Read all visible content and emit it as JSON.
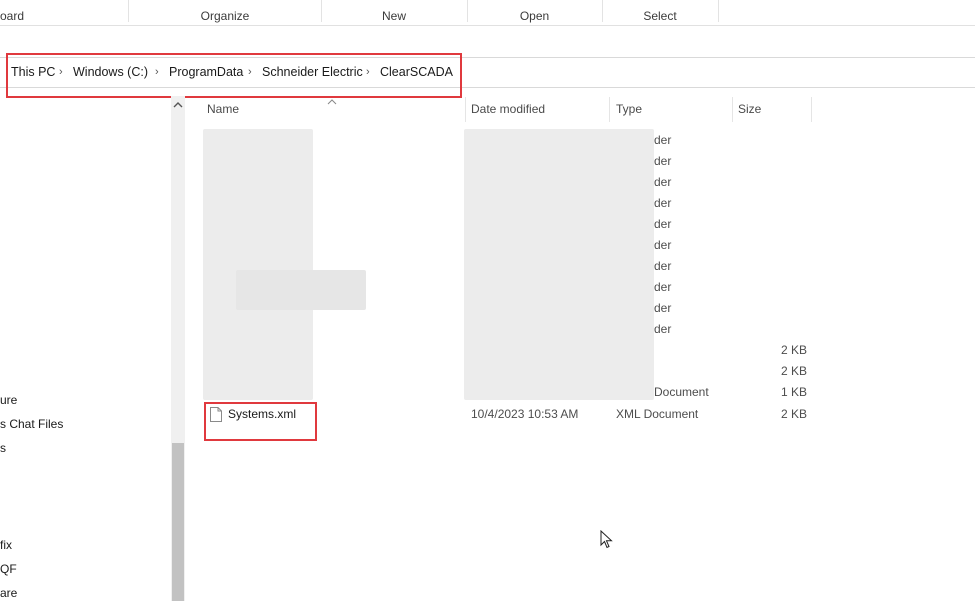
{
  "ribbon": {
    "groups": [
      "oard",
      "Organize",
      "New",
      "Open",
      "Select"
    ]
  },
  "breadcrumb": {
    "items": [
      "This PC",
      "Windows (C:)",
      "ProgramData",
      "Schneider Electric",
      "ClearSCADA"
    ],
    "separator": "›"
  },
  "nav": {
    "items": [
      "ure",
      "s Chat Files",
      "s",
      "fix",
      "QF",
      "are"
    ]
  },
  "columns": {
    "name": "Name",
    "date": "Date modified",
    "type": "Type",
    "size": "Size"
  },
  "partial_rows": [
    {
      "type": "der",
      "size": ""
    },
    {
      "type": "der",
      "size": ""
    },
    {
      "type": "der",
      "size": ""
    },
    {
      "type": "der",
      "size": ""
    },
    {
      "type": "der",
      "size": ""
    },
    {
      "type": "der",
      "size": ""
    },
    {
      "type": "der",
      "size": ""
    },
    {
      "type": "der",
      "size": ""
    },
    {
      "type": "der",
      "size": ""
    },
    {
      "type": "der",
      "size": ""
    },
    {
      "type": "",
      "size": "2 KB"
    },
    {
      "type": "",
      "size": "2 KB"
    },
    {
      "type": "Document",
      "size": "1 KB"
    }
  ],
  "file": {
    "name": "Systems.xml",
    "date": "10/4/2023 10:53 AM",
    "type": "XML Document",
    "size": "2 KB"
  },
  "colors": {
    "highlight": "#e0393e"
  }
}
